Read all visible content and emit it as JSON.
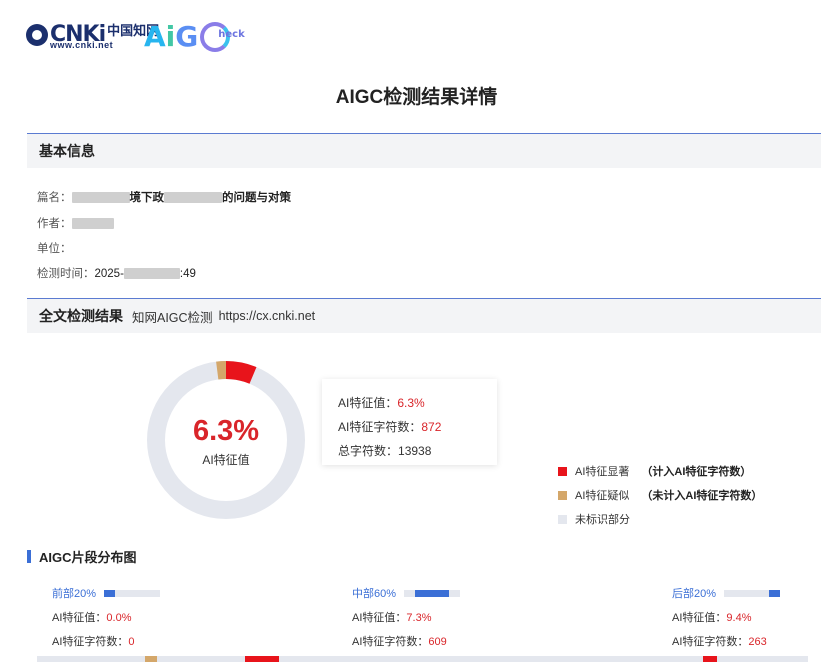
{
  "logo": {
    "cnki_text": "CNKi",
    "cnki_cn": "中国知网",
    "cnki_url": "www.cnki.net",
    "aigc_a": "A",
    "aigc_i": "i",
    "aigc_g": "G",
    "aigc_heck": "heck"
  },
  "page_title": "AIGC检测结果详情",
  "basic_info": {
    "section_title": "基本信息",
    "title_label": "篇名：",
    "title_part1": "境下政",
    "title_part2": "的问题与对策",
    "author_label": "作者：",
    "unit_label": "单位：",
    "time_label": "检测时间：",
    "time_prefix": "2025-",
    "time_suffix": ":49"
  },
  "result": {
    "section_title": "全文检测结果",
    "source": "知网AIGC检测",
    "url": "https://cx.cnki.net",
    "ai_percent": "6.3%",
    "ai_percent_label": "AI特征值",
    "ai_fraction": 0.063,
    "similar_fraction": 0.02,
    "stats": {
      "ai_value_label": "AI特征值：",
      "ai_value": "6.3%",
      "ai_chars_label": "AI特征字符数：",
      "ai_chars": "872",
      "total_chars_label": "总字符数：",
      "total_chars": "13938"
    },
    "legend": [
      {
        "label": "AI特征显著",
        "note": "（计入AI特征字符数）",
        "color": "#e8141b"
      },
      {
        "label": "AI特征疑似",
        "note": "（未计入AI特征字符数）",
        "color": "#d4a76a"
      },
      {
        "label": "未标识部分",
        "note": "",
        "color": "#e4e7ee"
      }
    ]
  },
  "distribution": {
    "title": "AIGC片段分布图",
    "segments": [
      {
        "name": "前部20%",
        "ai_value_label": "AI特征值：",
        "ai_value": "0.0%",
        "ai_chars_label": "AI特征字符数：",
        "ai_chars": "0",
        "fill_start": 0.0,
        "fill_fraction": 0.2
      },
      {
        "name": "中部60%",
        "ai_value_label": "AI特征值：",
        "ai_value": "7.3%",
        "ai_chars_label": "AI特征字符数：",
        "ai_chars": "609",
        "fill_start": 0.2,
        "fill_fraction": 0.6
      },
      {
        "name": "后部20%",
        "ai_value_label": "AI特征值：",
        "ai_value": "9.4%",
        "ai_chars_label": "AI特征字符数：",
        "ai_chars": "263",
        "fill_start": 0.8,
        "fill_fraction": 0.2
      }
    ]
  },
  "colors": {
    "ai_significant": "#e8141b",
    "ai_suspected": "#d4a76a",
    "unmarked": "#e4e7ee",
    "accent_blue": "#3b6fd6"
  }
}
